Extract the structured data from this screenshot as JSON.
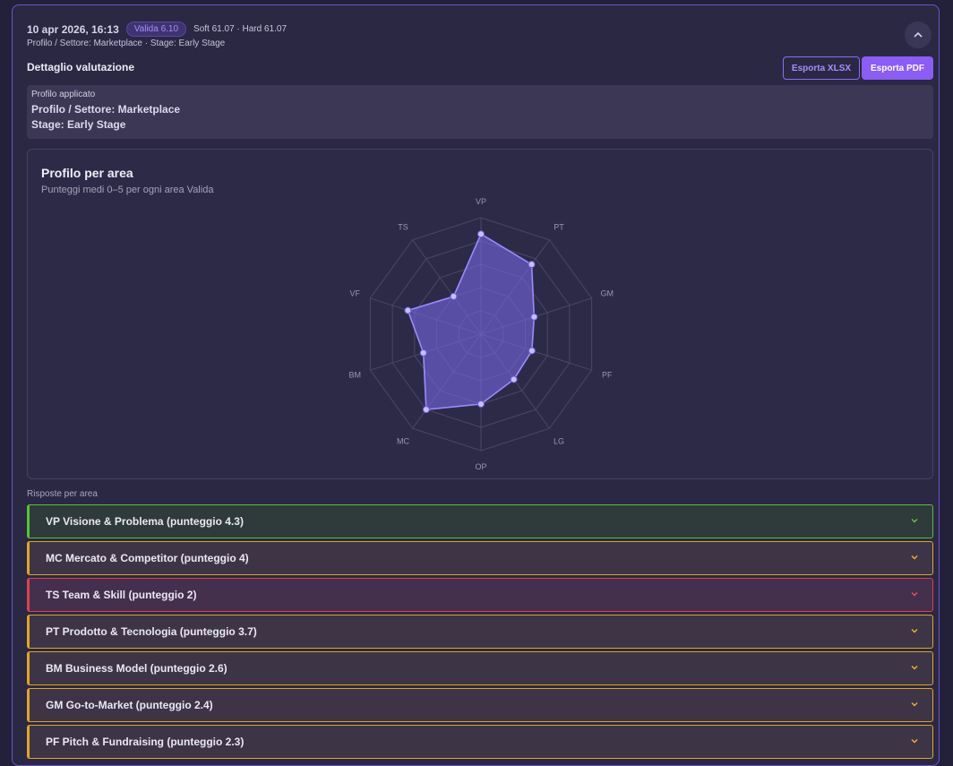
{
  "header": {
    "date": "10 apr 2026, 16:13",
    "badge": "Valida 6.10",
    "scores": "Soft 61.07 · Hard 61.07",
    "subline": "Profilo / Settore: Marketplace · Stage: Early Stage",
    "collapse_icon": "chevron-up-icon"
  },
  "detail": {
    "title": "Dettaglio valutazione",
    "export_xlsx": "Esporta XLSX",
    "export_pdf": "Esporta PDF"
  },
  "profile": {
    "label": "Profilo applicato",
    "sector": "Profilo / Settore: Marketplace",
    "stage": "Stage: Early Stage"
  },
  "chart_data": {
    "type": "radar",
    "title": "Profilo per area",
    "subtitle": "Punteggi medi 0–5 per ogni area Valida",
    "axes": [
      "VP",
      "PT",
      "GM",
      "PF",
      "LG",
      "OP",
      "MC",
      "BM",
      "VF",
      "TS"
    ],
    "values": [
      4.3,
      3.7,
      2.4,
      2.3,
      2.4,
      3.0,
      4.0,
      2.6,
      3.3,
      2.0
    ],
    "range": [
      0,
      5
    ],
    "rings": 5,
    "colors": {
      "fill": "#7c6cf0",
      "stroke": "#9a8cff",
      "grid": "#4a4664",
      "label": "#9a96b0"
    }
  },
  "areas": {
    "label": "Risposte per area",
    "items": [
      {
        "label": "VP Visione & Problema (punteggio 4.3)",
        "status": "green"
      },
      {
        "label": "MC Mercato & Competitor (punteggio 4)",
        "status": "amber"
      },
      {
        "label": "TS Team & Skill (punteggio 2)",
        "status": "red"
      },
      {
        "label": "PT Prodotto & Tecnologia (punteggio 3.7)",
        "status": "amber"
      },
      {
        "label": "BM Business Model (punteggio 2.6)",
        "status": "amber"
      },
      {
        "label": "GM Go-to-Market (punteggio 2.4)",
        "status": "amber"
      },
      {
        "label": "PF Pitch & Fundraising (punteggio 2.3)",
        "status": "amber"
      }
    ],
    "chevron_icon": "chevron-down-icon"
  }
}
